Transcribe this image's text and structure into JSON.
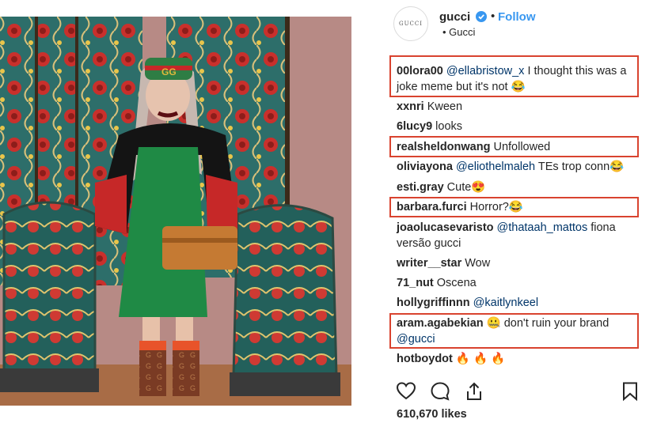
{
  "post": {
    "username": "gucci",
    "separator": "•",
    "follow_label": "Follow",
    "location": "• Gucci",
    "avatar_text": "GUCCI"
  },
  "comments": [
    {
      "user": "00lora00",
      "mention": "@ellabristow_x",
      "text": " I thought this was a joke meme but it's not 😂",
      "highlighted": true
    },
    {
      "user": "xxnri",
      "mention": "",
      "text": " Kween",
      "highlighted": false
    },
    {
      "user": "6lucy9",
      "mention": "",
      "text": " looks",
      "highlighted": false
    },
    {
      "user": "realsheldonwang",
      "mention": "",
      "text": " Unfollowed",
      "highlighted": true
    },
    {
      "user": "oliviayona",
      "mention": "@eliothelmaleh",
      "text": " TEs trop conn😂",
      "highlighted": false
    },
    {
      "user": "esti.gray",
      "mention": "",
      "text": " Cute😍",
      "highlighted": false
    },
    {
      "user": "barbara.furci",
      "mention": "",
      "text": " Horror?😂",
      "highlighted": true
    },
    {
      "user": "joaolucasevaristo",
      "mention": "@thataah_mattos",
      "text": " fiona versão gucci",
      "highlighted": false
    },
    {
      "user": "writer__star",
      "mention": "",
      "text": " Wow",
      "highlighted": false
    },
    {
      "user": "71_nut",
      "mention": "",
      "text": " Oscena",
      "highlighted": false
    },
    {
      "user": "hollygriffinnn",
      "mention": "@kaitlynkeel",
      "text": "",
      "highlighted": false
    },
    {
      "user": "aram.agabekian",
      "mention": "",
      "text": " 🤐  don't ruin your brand ",
      "mention_after": "@gucci",
      "highlighted": true
    },
    {
      "user": "hotboydot",
      "mention": "",
      "text": " 🔥 🔥 🔥",
      "highlighted": false
    }
  ],
  "actions": {
    "icons": [
      "heart-icon",
      "comment-icon",
      "share-icon",
      "bookmark-icon"
    ]
  },
  "likes": "610,670 likes",
  "colors": {
    "follow": "#3897f0",
    "mention": "#003569",
    "highlight_box": "#d9432f",
    "verified": "#3897f0"
  }
}
